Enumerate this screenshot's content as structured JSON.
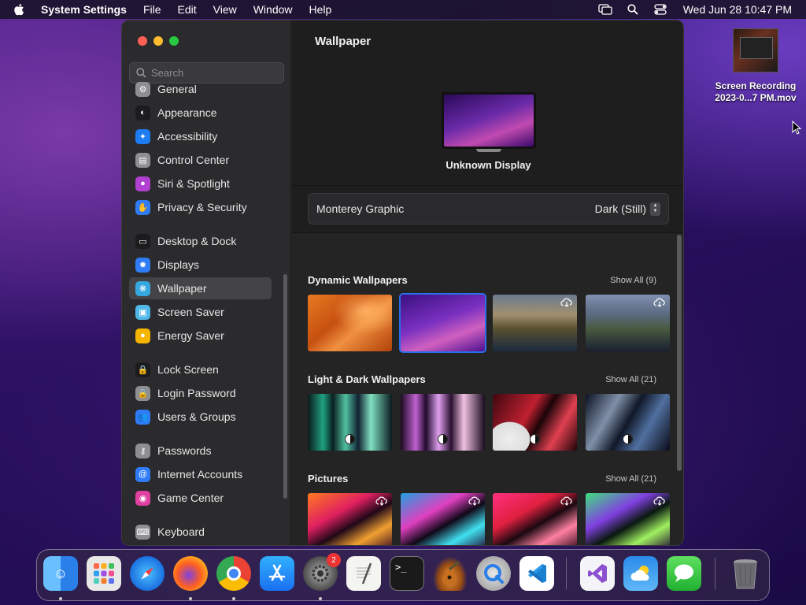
{
  "menubar": {
    "app_name": "System Settings",
    "items": [
      "File",
      "Edit",
      "View",
      "Window",
      "Help"
    ],
    "clock": "Wed Jun 28  10:47 PM"
  },
  "sidebar": {
    "search_placeholder": "Search",
    "items": [
      {
        "label": "General",
        "color": "#8e8e93",
        "icon": "gear-icon"
      },
      {
        "label": "Appearance",
        "color": "#1c1c1e",
        "icon": "appearance-icon"
      },
      {
        "label": "Accessibility",
        "color": "#1e7cf2",
        "icon": "accessibility-icon"
      },
      {
        "label": "Control Center",
        "color": "#8e8e93",
        "icon": "control-center-icon"
      },
      {
        "label": "Siri & Spotlight",
        "color": "#b040d0",
        "icon": "siri-icon"
      },
      {
        "label": "Privacy & Security",
        "color": "#2f7cf6",
        "icon": "hand-icon"
      },
      {
        "label": "Desktop & Dock",
        "color": "#1c1c1e",
        "icon": "dock-icon"
      },
      {
        "label": "Displays",
        "color": "#2f7cf6",
        "icon": "sun-icon"
      },
      {
        "label": "Wallpaper",
        "color": "#35a8e0",
        "icon": "wallpaper-icon"
      },
      {
        "label": "Screen Saver",
        "color": "#50b8e8",
        "icon": "screen-saver-icon"
      },
      {
        "label": "Energy Saver",
        "color": "#f5b400",
        "icon": "bulb-icon"
      },
      {
        "label": "Lock Screen",
        "color": "#1c1c1e",
        "icon": "lock-icon"
      },
      {
        "label": "Login Password",
        "color": "#8e8e93",
        "icon": "lock-icon"
      },
      {
        "label": "Users & Groups",
        "color": "#2f7cf6",
        "icon": "users-icon"
      },
      {
        "label": "Passwords",
        "color": "#8e8e93",
        "icon": "key-icon"
      },
      {
        "label": "Internet Accounts",
        "color": "#2f7cf6",
        "icon": "at-icon"
      },
      {
        "label": "Game Center",
        "color": "#e040a0",
        "icon": "game-center-icon"
      },
      {
        "label": "Keyboard",
        "color": "#8e8e93",
        "icon": "keyboard-icon"
      }
    ],
    "selected_index": 8
  },
  "main": {
    "title": "Wallpaper",
    "display_name": "Unknown Display",
    "wallpaper_name": "Monterey Graphic",
    "mode_value": "Dark (Still)",
    "sections": [
      {
        "title": "Dynamic Wallpapers",
        "show_all": "Show All (9)"
      },
      {
        "title": "Light & Dark Wallpapers",
        "show_all": "Show All (21)"
      },
      {
        "title": "Pictures",
        "show_all": "Show All (21)"
      }
    ]
  },
  "desktop": {
    "file_name_line1": "Screen Recording",
    "file_name_line2": "2023-0...7 PM.mov"
  },
  "dock": {
    "badge_count": "2",
    "apps": [
      "Finder",
      "Launchpad",
      "Safari",
      "Firefox",
      "Chrome",
      "App Store",
      "System Settings",
      "TextEdit",
      "Terminal",
      "GarageBand",
      "QuickTime Player",
      "VS Code",
      "Visual Studio",
      "Weather",
      "Messages",
      "Trash"
    ]
  }
}
